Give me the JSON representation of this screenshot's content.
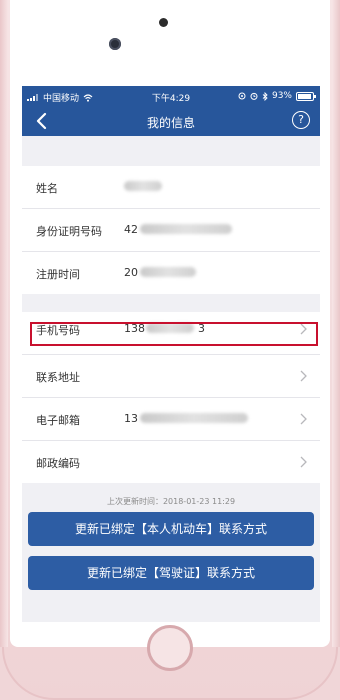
{
  "status_bar": {
    "carrier": "中国移动",
    "time": "下午4:29",
    "battery_percent": "93%",
    "battery_level": 0.93
  },
  "nav": {
    "title": "我的信息",
    "back_icon": "chevron-left-icon",
    "help_label": "?"
  },
  "info_group_1": {
    "rows": [
      {
        "label": "姓名",
        "value_prefix": ""
      },
      {
        "label": "身份证明号码",
        "value_prefix": "42"
      },
      {
        "label": "注册时间",
        "value_prefix": "20"
      }
    ]
  },
  "info_group_2": {
    "rows": [
      {
        "label": "手机号码",
        "value_prefix": "138",
        "value_suffix": "3"
      },
      {
        "label": "联系地址",
        "value_prefix": ""
      },
      {
        "label": "电子邮箱",
        "value_prefix": "13"
      },
      {
        "label": "邮政编码",
        "value_prefix": ""
      }
    ]
  },
  "last_update": "上次更新时间：2018-01-23 11:29",
  "buttons": {
    "vehicle": "更新已绑定【本人机动车】联系方式",
    "license": "更新已绑定【驾驶证】联系方式"
  },
  "colors": {
    "nav_bar": "#27569b",
    "button": "#2d5da4",
    "highlight_box": "#c8102e",
    "page_bg": "#f0f0f4"
  }
}
